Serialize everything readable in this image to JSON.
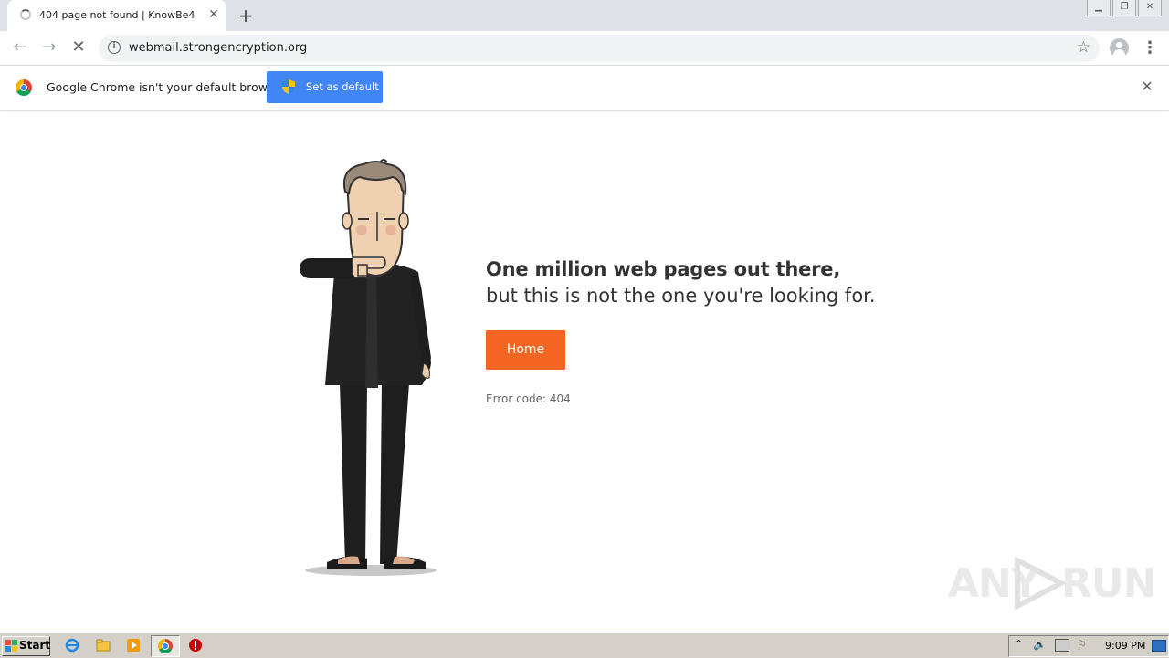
{
  "browser": {
    "tab": {
      "title": "404 page not found | KnowBe4"
    },
    "window_buttons": [
      "minimize",
      "restore",
      "close"
    ],
    "address_bar": {
      "url": "webmail.strongencryption.org"
    }
  },
  "infobar": {
    "message": "Google Chrome isn't your default browser",
    "button_label": "Set as default"
  },
  "page": {
    "headline": "One million web pages out there,",
    "subline": "but this is not the one you're looking for.",
    "home_button": "Home",
    "error_code": "Error code: 404"
  },
  "watermark": {
    "left": "ANY",
    "right": "RUN"
  },
  "taskbar": {
    "start_label": "Start",
    "clock": "9:09 PM"
  },
  "colors": {
    "accent_orange": "#f26522",
    "chrome_blue": "#4285f4",
    "tabstrip": "#dee1e6",
    "taskbar": "#d4d0c8"
  }
}
